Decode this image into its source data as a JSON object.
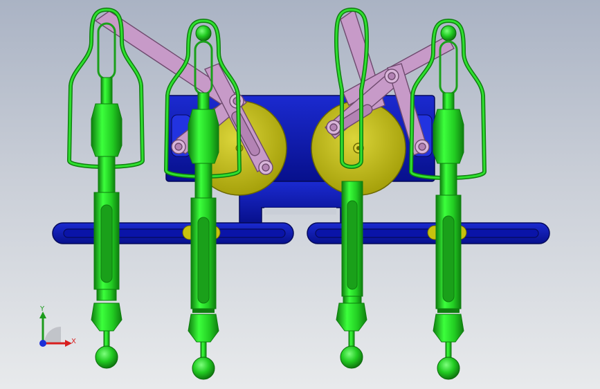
{
  "viewport": {
    "background_top": "#aab3c4",
    "background_bottom": "#e8eaec"
  },
  "colors": {
    "leg_green": "#26d626",
    "leg_green_dark": "#0f7d0f",
    "frame_blue": "#0a14a8",
    "frame_blue_dark": "#050a5a",
    "disc_olive": "#c8c20e",
    "disc_olive_dark": "#6b6800",
    "link_pink": "#c79ac8",
    "link_pink_dark": "#6e4a6e",
    "axis_x": "#d81e1e",
    "axis_y": "#1c9b1c",
    "axis_z": "#1c2fd8"
  },
  "model": {
    "parts": [
      "frame",
      "crank-disc-left",
      "crank-disc-right",
      "link-arms",
      "legs"
    ]
  },
  "triad": {
    "x_label": "X",
    "y_label": "Y"
  }
}
